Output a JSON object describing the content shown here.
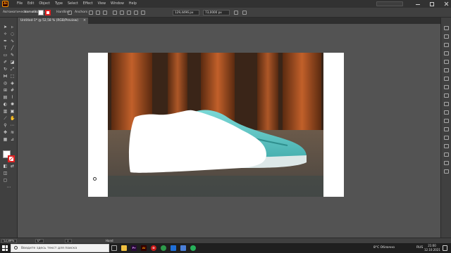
{
  "app": {
    "logo_text": "Ai",
    "workspace": "Автоматическая область"
  },
  "menu": [
    "File",
    "Edit",
    "Object",
    "Type",
    "Select",
    "Effect",
    "View",
    "Window",
    "Help"
  ],
  "control_bar": {
    "selection_label": "Unmask",
    "stroke_label": "Hardline",
    "width_label": "Anchors",
    "x_value": "129,4496 px",
    "y_value": "73,0000 px",
    "fill_color": "#ffffff",
    "stroke_color": "#e02020"
  },
  "document_tab": {
    "title": "Untitled-1* @ 52,58 % (RGB/Preview)",
    "close": "×"
  },
  "status_bar": {
    "zoom": "52,89%",
    "rotation": "0°",
    "artboard_number": "1",
    "tool_name": "Hand"
  },
  "taskbar": {
    "search_placeholder": "Введите здесь текст для поиска",
    "apps": [
      {
        "name": "file-explorer",
        "label": "",
        "color": "#f0c040"
      },
      {
        "name": "premiere",
        "label": "Pr",
        "color": "#2a0a3a"
      },
      {
        "name": "illustrator",
        "label": "Ai",
        "color": "#330000"
      },
      {
        "name": "opera",
        "label": "O",
        "color": "#cc1a1a"
      },
      {
        "name": "chrome",
        "label": "",
        "color": "#2d9b4a"
      },
      {
        "name": "photos",
        "label": "",
        "color": "#1f6fd8"
      },
      {
        "name": "mail",
        "label": "",
        "color": "#4a7fd8"
      },
      {
        "name": "whatsapp",
        "label": "",
        "color": "#26b15a"
      }
    ],
    "weather": "8°C  Облачно",
    "language": "RUS",
    "time": "21:00",
    "date": "12.10.2021"
  },
  "colors": {
    "artboard": "#ffffff",
    "canvas": "#535353",
    "shoe": "#5ec9c8",
    "sole": "#e8f2f2"
  }
}
